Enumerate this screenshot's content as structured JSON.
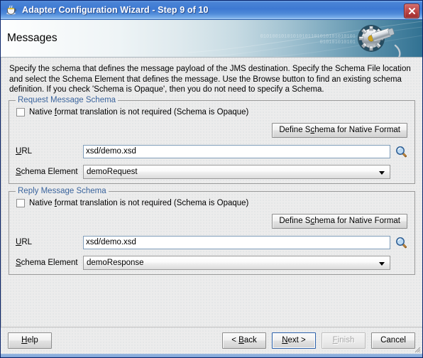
{
  "window": {
    "title": "Adapter Configuration Wizard - Step 9 of 10",
    "app_icon": "java-coffee-cup-icon",
    "close_label": "✕"
  },
  "banner": {
    "heading": "Messages",
    "art_icon": "gear-plug-graphic",
    "binary_line1": "01010010101010101101010101010101",
    "binary_line2": "010101010101"
  },
  "description": "Specify the schema that defines the message payload of the JMS destination.  Specify the Schema File location and select the Schema Element that defines the message. Use the Browse button to find an existing schema definition. If you check 'Schema is Opaque', then you do not need to specify a Schema.",
  "groups": [
    {
      "title": "Request Message Schema",
      "checkbox_label_pre": "Native ",
      "checkbox_mnemonic": "f",
      "checkbox_label_post": "ormat translation is not required (Schema is Opaque)",
      "checkbox_checked": false,
      "define_button_pre": "Define S",
      "define_button_mnemonic": "c",
      "define_button_post": "hema for Native Format",
      "url_label_mnemonic": "U",
      "url_label_post": "RL",
      "url_value": "xsd/demo.xsd",
      "url_placeholder": "",
      "browse_icon": "magnifier-icon",
      "element_label_mnemonic": "S",
      "element_label_post": "chema Element",
      "element_value": "demoRequest"
    },
    {
      "title": "Reply Message Schema",
      "checkbox_label_pre": "Native ",
      "checkbox_mnemonic": "f",
      "checkbox_label_post": "ormat translation is not required (Schema is Opaque)",
      "checkbox_checked": false,
      "define_button_pre": "Define S",
      "define_button_mnemonic": "c",
      "define_button_post": "hema for Native Format",
      "url_label_mnemonic": "U",
      "url_label_post": "RL",
      "url_value": "xsd/demo.xsd",
      "url_placeholder": "",
      "browse_icon": "magnifier-icon",
      "element_label_mnemonic": "S",
      "element_label_post": "chema Element",
      "element_value": "demoResponse"
    }
  ],
  "buttonbar": {
    "help_mnemonic": "H",
    "help_post": "elp",
    "back_pre": "< ",
    "back_mnemonic": "B",
    "back_post": "ack",
    "next_mnemonic": "N",
    "next_post": "ext >",
    "next_focused": true,
    "finish_mnemonic": "F",
    "finish_post": "inish",
    "finish_disabled": true,
    "cancel_label": "Cancel"
  },
  "colors": {
    "title_bar": "#3e79d2",
    "group_title": "#39639c",
    "banner_right": "#43809e",
    "close_button": "#9e2b2b",
    "focus_border": "#2a5fa8"
  }
}
